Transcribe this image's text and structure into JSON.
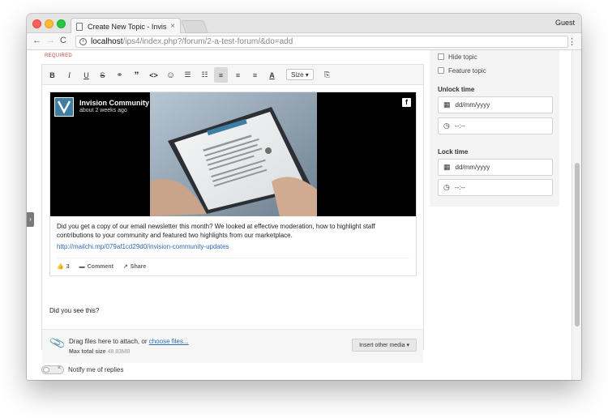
{
  "browser": {
    "tab_title": "Create New Topic - Invision Co",
    "user": "Guest",
    "url_host": "localhost",
    "url_path": "/ips4/index.php?/forum/2-a-test-forum/&do=add"
  },
  "form": {
    "required_label": "REQUIRED",
    "toolbar": {
      "bold": "B",
      "italic": "I",
      "underline": "U",
      "strike": "S",
      "link": "⚭",
      "quote": "”",
      "code": "<>",
      "emoji": "☺",
      "bullets": "☰",
      "numbers": "☷",
      "align_left": "≡",
      "align_center": "≡",
      "align_right": "≡",
      "text_color": "A",
      "size_label": "Size",
      "source": "⎘"
    },
    "embed": {
      "brand": "Invision Community",
      "time_ago": "about 2 weeks ago",
      "caption": "Did you get a copy of our email newsletter this month? We looked at effective moderation, how to highlight staff contributions to your community and featured two highlights from our marketplace.",
      "link": "http://mailchi.mp/079af1cd29d0/invision-community-updates",
      "likes": "3",
      "comment_label": "Comment",
      "share_label": "Share"
    },
    "body_text": "Did you see this?",
    "attach": {
      "drag_text": "Drag files here to attach, or",
      "choose_files": "choose files...",
      "max_label": "Max total size",
      "max_value": "48.83MB",
      "insert_media": "Insert other media"
    },
    "notify_label": "Notify me of replies"
  },
  "sidebar": {
    "hide_topic": "Hide topic",
    "feature_topic": "Feature topic",
    "unlock_time": "Unlock time",
    "lock_time": "Lock time",
    "date_placeholder": "dd/mm/yyyy",
    "time_placeholder": "--:--"
  },
  "colors": {
    "link": "#2f6bb3",
    "required": "#c64444",
    "brand_tile": "#3e7ea2"
  }
}
